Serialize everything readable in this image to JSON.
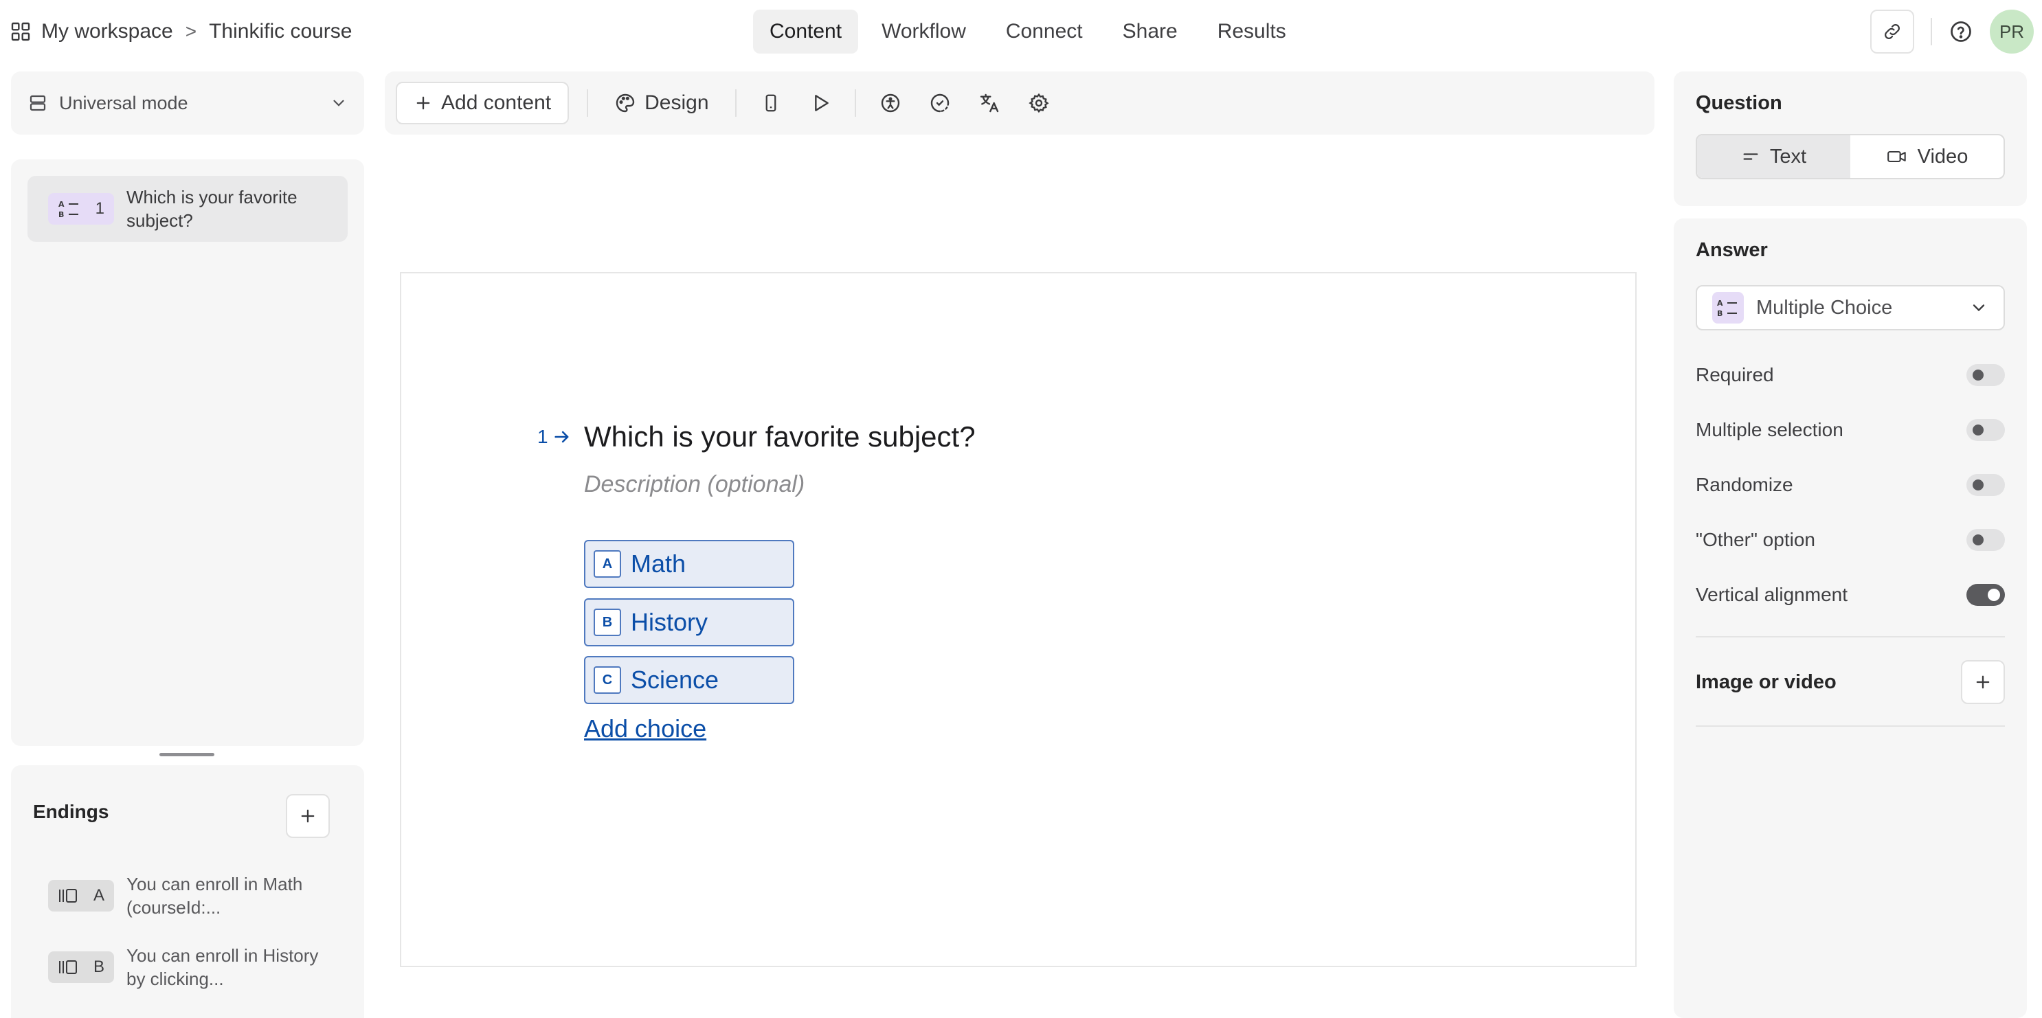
{
  "breadcrumb": {
    "workspace": "My workspace",
    "separator": ">",
    "course": "Thinkific course"
  },
  "nav": {
    "tabs": [
      {
        "label": "Content",
        "active": true
      },
      {
        "label": "Workflow"
      },
      {
        "label": "Connect"
      },
      {
        "label": "Share"
      },
      {
        "label": "Results"
      }
    ]
  },
  "user": {
    "initials": "PR"
  },
  "sidebar": {
    "mode_label": "Universal mode",
    "questions": [
      {
        "number": "1",
        "text": "Which is your favorite subject?"
      }
    ],
    "endings_title": "Endings",
    "endings": [
      {
        "key": "A",
        "text": "You can enroll in Math (courseId:..."
      },
      {
        "key": "B",
        "text": "You can enroll in History by clicking..."
      }
    ]
  },
  "toolbar": {
    "add_content": "Add content",
    "design": "Design"
  },
  "question": {
    "number": "1",
    "title": "Which is your favorite subject?",
    "description_placeholder": "Description (optional)",
    "choices": [
      {
        "key": "A",
        "label": "Math"
      },
      {
        "key": "B",
        "label": "History"
      },
      {
        "key": "C",
        "label": "Science"
      }
    ],
    "add_choice": "Add choice"
  },
  "settings": {
    "question_title": "Question",
    "text_label": "Text",
    "video_label": "Video",
    "answer_title": "Answer",
    "answer_type": "Multiple Choice",
    "toggles": [
      {
        "label": "Required",
        "on": false
      },
      {
        "label": "Multiple selection",
        "on": false
      },
      {
        "label": "Randomize",
        "on": false
      },
      {
        "label": "\"Other\" option",
        "on": false
      },
      {
        "label": "Vertical alignment",
        "on": true
      }
    ],
    "media_title": "Image or video"
  },
  "colors": {
    "accent": "#0b4ea8",
    "choice_bg": "#e7ecf6",
    "choice_border": "#4f79bf",
    "badge_purple": "#e6dcf7",
    "avatar": "#c9e8c6"
  }
}
